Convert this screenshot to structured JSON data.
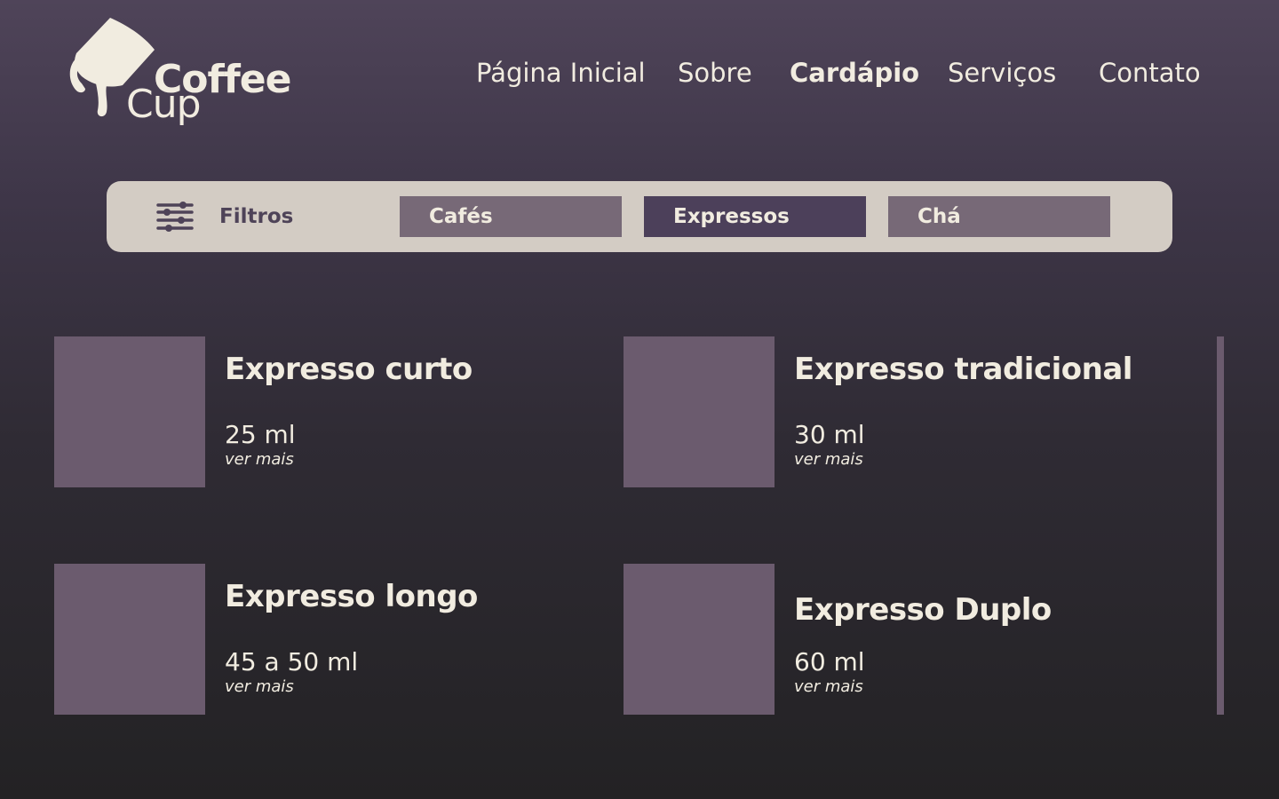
{
  "brand": {
    "line1": "Coffee",
    "line2": "Cup",
    "logo_icon": "coffee-cup-pouring-icon"
  },
  "nav": {
    "items": [
      {
        "label": "Página Inicial",
        "active": false
      },
      {
        "label": "Sobre",
        "active": false
      },
      {
        "label": "Cardápio",
        "active": true
      },
      {
        "label": "Serviços",
        "active": false
      },
      {
        "label": "Contato",
        "active": false
      }
    ]
  },
  "filters": {
    "icon": "sliders-icon",
    "label": "Filtros",
    "options": [
      {
        "label": "Cafés",
        "active": false
      },
      {
        "label": "Expressos",
        "active": true
      },
      {
        "label": "Chá",
        "active": false
      }
    ]
  },
  "products": [
    {
      "name": "Expresso curto",
      "volume": "25 ml",
      "more": "ver mais"
    },
    {
      "name": "Expresso tradicional",
      "volume": "30 ml",
      "more": "ver mais"
    },
    {
      "name": "Expresso longo",
      "volume": "45 a 50 ml",
      "more": "ver mais"
    },
    {
      "name": "Expresso Duplo",
      "volume": "60 ml",
      "more": "ver mais"
    }
  ],
  "colors": {
    "background_top": "#4f4459",
    "background_bottom": "#232224",
    "text": "#f1ece0",
    "filter_bar": "#d3ccc4",
    "filter_button": "#776977",
    "filter_button_active": "#4c405a",
    "thumbnail": "#6b5b6e"
  }
}
